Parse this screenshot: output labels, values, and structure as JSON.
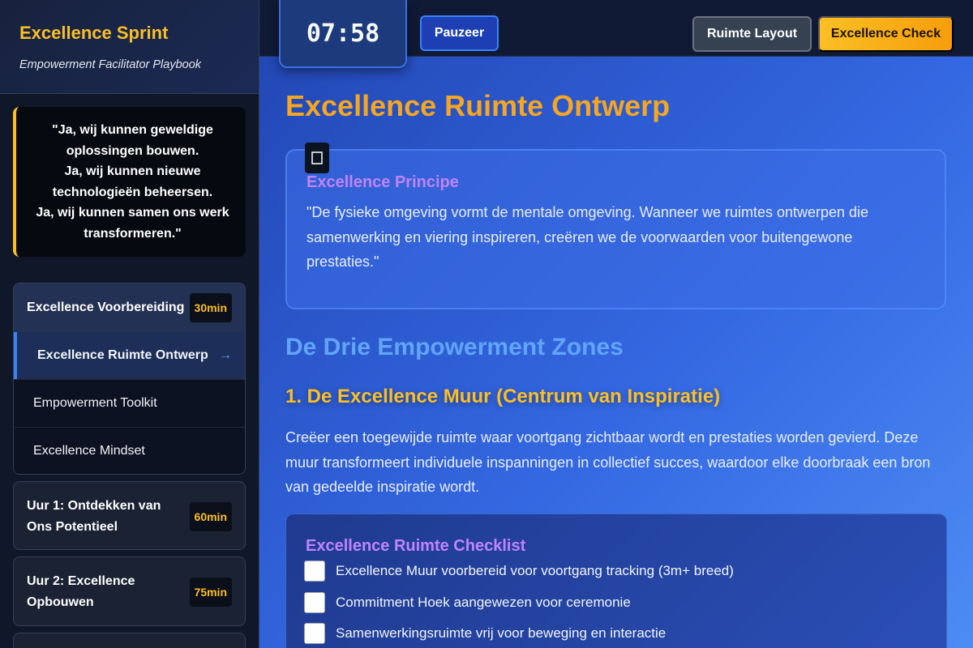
{
  "sidebar": {
    "title": "Excellence Sprint",
    "subtitle": "Empowerment Facilitator Playbook",
    "quote": [
      "\"Ja, wij kunnen geweldige",
      "oplossingen bouwen.",
      "Ja, wij kunnen nieuwe",
      "technologieën beheersen.",
      "Ja, wij kunnen samen ons werk",
      "transformeren.\""
    ],
    "sections": [
      {
        "title": "Excellence Voorbereiding",
        "duration": "30min",
        "items": [
          {
            "label": "Excellence Ruimte Ontwerp",
            "active": true,
            "arrow": "→"
          },
          {
            "label": "Empowerment Toolkit"
          },
          {
            "label": "Excellence Mindset"
          }
        ]
      },
      {
        "title_line1": "Uur 1: Ontdekken van",
        "title_line2": "Ons Potentieel",
        "duration": "60min"
      },
      {
        "title_line1": "Uur 2: Excellence",
        "title_line2": "Opbouwen",
        "duration": "75min"
      }
    ]
  },
  "topbar": {
    "timer": "07:58",
    "pause_label": "Pauzeer",
    "layout_label": "Ruimte Layout",
    "check_label": "Excellence Check"
  },
  "main": {
    "title": "Excellence Ruimte Ontwerp",
    "principle": {
      "icon": "square-icon",
      "title": "Excellence Principe",
      "text": "\"De fysieke omgeving vormt de mentale omgeving. Wanneer we ruimtes ontwerpen die samenwerking en viering inspireren, creëren we de voorwaarden voor buitengewone prestaties.\""
    },
    "zones_heading": "De Drie Empowerment Zones",
    "zone1_heading": "1. De Excellence Muur (Centrum van Inspiratie)",
    "zone1_text": "Creëer een toegewijde ruimte waar voortgang zichtbaar wordt en prestaties worden gevierd. Deze muur transformeert individuele inspanningen in collectief succes, waardoor elke doorbraak een bron van gedeelde inspiratie wordt.",
    "checklist": {
      "title": "Excellence Ruimte Checklist",
      "items": [
        "Excellence Muur voorbereid voor voortgang tracking (3m+ breed)",
        "Commitment Hoek aangewezen voor ceremonie",
        "Samenwerkingsruimte vrij voor beweging en interactie"
      ]
    }
  },
  "colors": {
    "accent_gold": "#fbbf24",
    "accent_blue": "#3b82f6",
    "accent_purple": "#c084fc"
  }
}
